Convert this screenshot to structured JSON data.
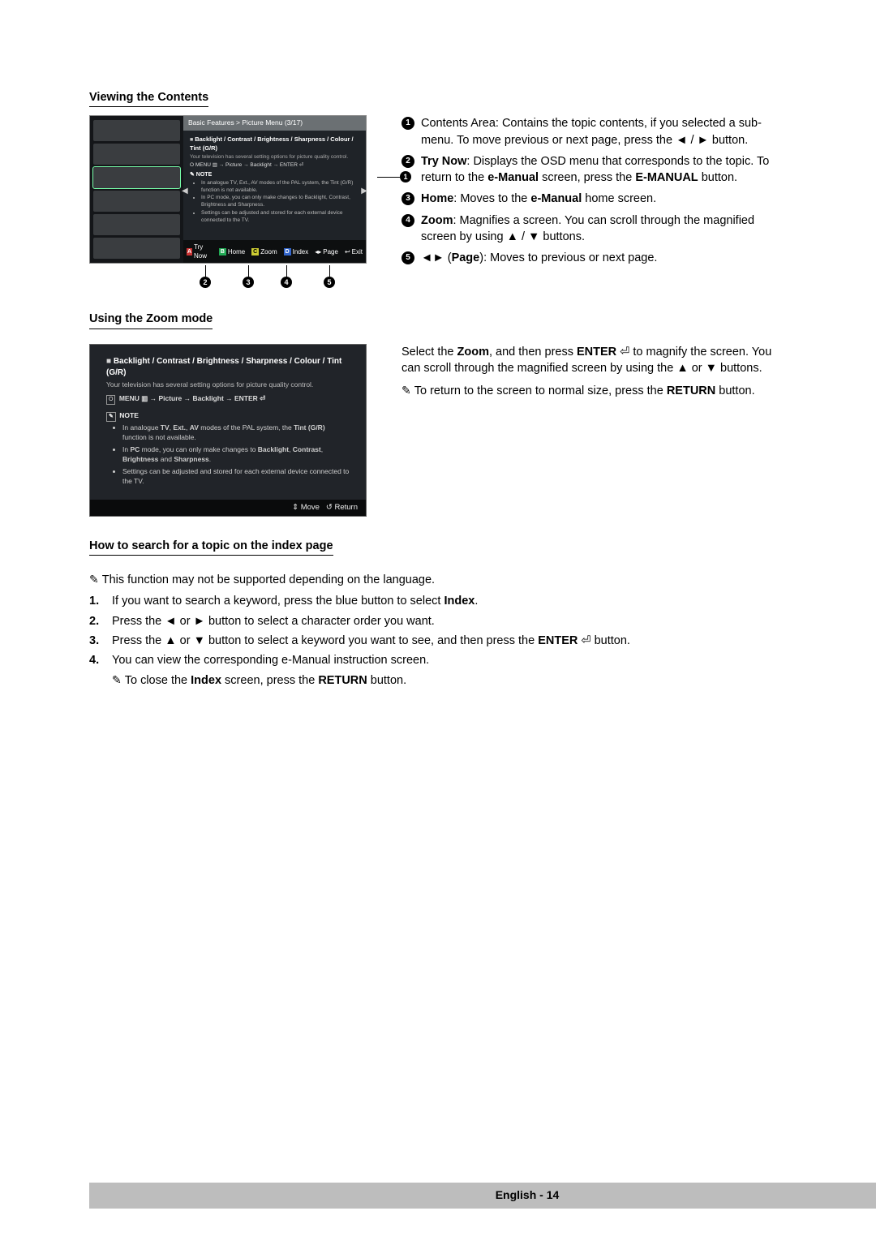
{
  "sections": {
    "viewing": "Viewing the Contents",
    "zoom": "Using the Zoom mode",
    "index": "How to search for a topic on the index page"
  },
  "shot1": {
    "title": "Basic Features > Picture Menu (3/17)",
    "headline_sq": "■",
    "headline": "Backlight / Contrast / Brightness / Sharpness / Colour / Tint (G/R)",
    "sub": "Your television has several setting options for picture quality control.",
    "menu_line": "O MENU ▥ → Picture → Backlight → ENTER ⏎",
    "note_label": "✎ NOTE",
    "notes": [
      "In analogue TV, Ext., AV modes of the PAL system, the Tint (G/R) function is not available.",
      "In PC mode, you can only make changes to Backlight, Contrast, Brightness and Sharpness.",
      "Settings can be adjusted and stored for each external device connected to the TV."
    ],
    "footer": {
      "a": "Try Now",
      "b": "Home",
      "c": "Zoom",
      "d": "Index",
      "page": "Page",
      "exit": "Exit"
    }
  },
  "callouts": {
    "c1": {
      "html": "Contents Area: Contains the topic contents, if you selected a sub-menu. To move previous or next page, press the ◄ / ► button."
    },
    "c2": {
      "html": "<b>Try Now</b>: Displays the OSD menu that corresponds to the topic. To return to the <b>e-Manual</b> screen, press the <b>E-MANUAL</b> button."
    },
    "c3": {
      "html": "<b>Home</b>: Moves to the <b>e-Manual</b> home screen."
    },
    "c4": {
      "html": "<b>Zoom</b>: Magnifies a screen. You can scroll through the magnified screen by using ▲ / ▼ buttons."
    },
    "c5": {
      "html": "◄► (<b>Page</b>): Moves to previous or next page."
    }
  },
  "zoomShot": {
    "headline_sq": "■",
    "headline": "Backlight / Contrast / Brightness / Sharpness / Colour / Tint (G/R)",
    "sub": "Your television has several setting options for picture quality control.",
    "menu_line_icon": "O",
    "menu_line": "MENU ▥ → Picture → Backlight → ENTER ⏎",
    "note_icon": "✎",
    "note_label": "NOTE",
    "notes": [
      {
        "html": "In analogue <b>TV</b>, <b>Ext.</b>, <b>AV</b> modes of the PAL system, the <b>Tint (G/R)</b> function is not available."
      },
      {
        "html": "In <b>PC</b> mode, you can only make changes to <b>Backlight</b>, <b>Contrast</b>, <b>Brightness</b> and <b>Sharpness</b>."
      },
      {
        "html": "Settings can be adjusted and stored for each external device connected to the TV."
      }
    ],
    "footer": {
      "move": "Move",
      "ret": "Return",
      "move_icon": "⇕",
      "ret_icon": "↺"
    }
  },
  "zoomText": {
    "p1_html": "Select the <b>Zoom</b>, and then press <b>ENTER</b> ⏎ to magnify the screen. You can scroll through the magnified screen by using the ▲ or ▼ buttons.",
    "note_html": "To return to the screen to normal size, press the <b>RETURN</b>  button."
  },
  "indexSection": {
    "note_top": "This function may not be supported depending on the language.",
    "steps": [
      {
        "n": "1.",
        "html": "If you want to search a keyword, press the blue button to select <b>Index</b>."
      },
      {
        "n": "2.",
        "html": "Press the ◄ or ► button to select a character order you want."
      },
      {
        "n": "3.",
        "html": "Press the ▲ or ▼ button to select a keyword you want to see, and then press the <b>ENTER</b> ⏎ button."
      },
      {
        "n": "4.",
        "html": "You can view the corresponding e-Manual instruction screen."
      }
    ],
    "note_bottom_html": "To close the <b>Index</b> screen, press the <b>RETURN</b> button."
  },
  "footer": {
    "text": "English - 14"
  }
}
